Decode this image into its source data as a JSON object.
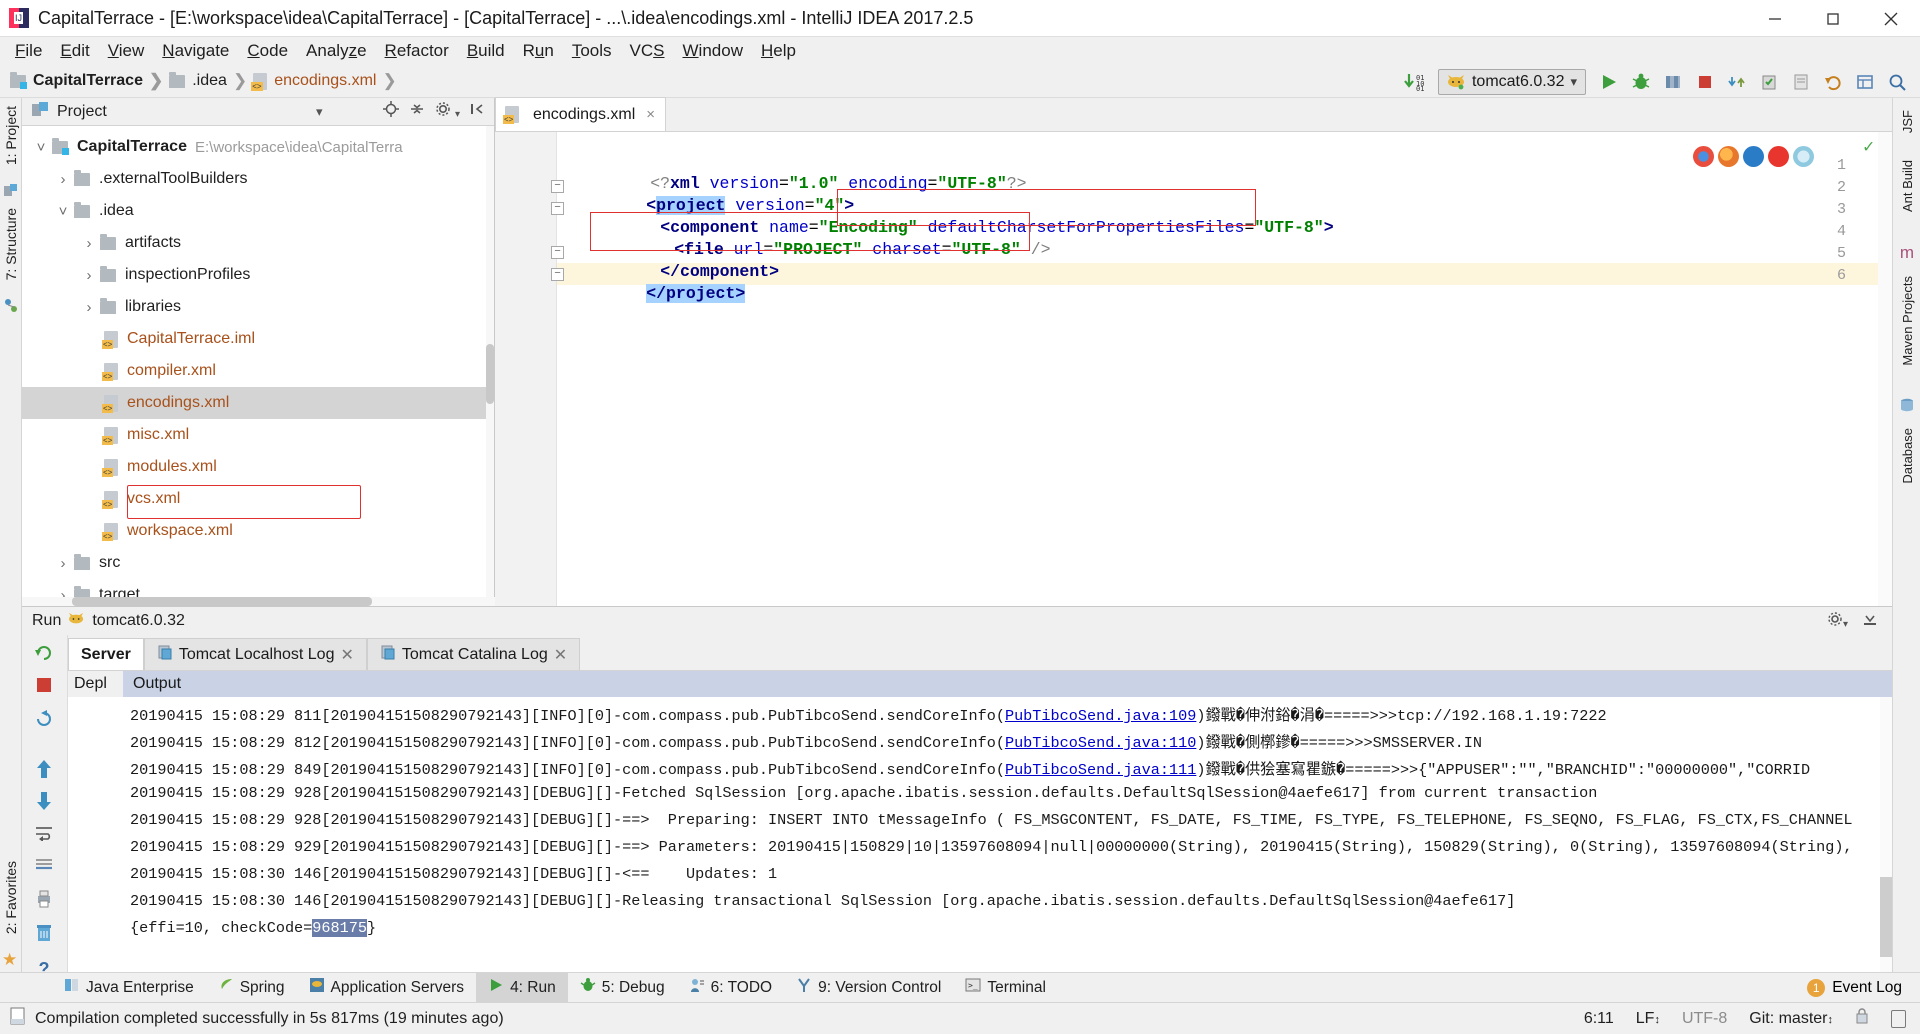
{
  "window": {
    "title": "CapitalTerrace - [E:\\workspace\\idea\\CapitalTerrace] - [CapitalTerrace] - ...\\.idea\\encodings.xml - IntelliJ IDEA 2017.2.5",
    "minimize_label": "minimize-icon",
    "maximize_label": "maximize-icon",
    "close_label": "close-icon"
  },
  "menu": {
    "items": [
      {
        "label": "File",
        "mnemonic": "F"
      },
      {
        "label": "Edit",
        "mnemonic": "E"
      },
      {
        "label": "View",
        "mnemonic": "V"
      },
      {
        "label": "Navigate",
        "mnemonic": "N"
      },
      {
        "label": "Code",
        "mnemonic": "C"
      },
      {
        "label": "Analyze",
        "mnemonic": "z"
      },
      {
        "label": "Refactor",
        "mnemonic": "R"
      },
      {
        "label": "Build",
        "mnemonic": "B"
      },
      {
        "label": "Run",
        "mnemonic": "u"
      },
      {
        "label": "Tools",
        "mnemonic": "T"
      },
      {
        "label": "VCS",
        "mnemonic": "S"
      },
      {
        "label": "Window",
        "mnemonic": "W"
      },
      {
        "label": "Help",
        "mnemonic": "H"
      }
    ]
  },
  "breadcrumb": {
    "items": [
      {
        "label": "CapitalTerrace",
        "icon": "module-folder-icon"
      },
      {
        "label": ".idea",
        "icon": "folder-icon"
      },
      {
        "label": "encodings.xml",
        "icon": "xml-file-icon"
      }
    ]
  },
  "toolbar": {
    "run_config": "tomcat6.0.32",
    "run_config_icon": "tomcat-cat-icon",
    "update_icon": "update-running-application-icon",
    "buttons": [
      "run-button",
      "debug-button",
      "run-coverage-button",
      "stop-button",
      "vcs-update-button",
      "vcs-commit-button",
      "vcs-rollback-button",
      "undo-button",
      "settings-button",
      "search-everywhere-button"
    ]
  },
  "left_strip": {
    "project_label": "1: Project",
    "structure_label": "7: Structure",
    "favorites_label": "2: Favorites"
  },
  "right_strip": {
    "items": [
      "JSF",
      "Ant Build",
      "Maven Projects",
      "Database"
    ]
  },
  "project_panel": {
    "title": "Project",
    "header_icons": [
      "project-view-icon",
      "chevron-down-icon",
      "locate-icon",
      "collapse-all-icon",
      "settings-gear-icon",
      "hide-icon"
    ],
    "tree": [
      {
        "label": "CapitalTerrace",
        "path": "E:\\workspace\\idea\\CapitalTerra",
        "indent": 0,
        "state": "expanded",
        "icon": "module-folder-icon",
        "bold": true
      },
      {
        "label": ".externalToolBuilders",
        "indent": 1,
        "state": "collapsed",
        "icon": "folder-icon"
      },
      {
        "label": ".idea",
        "indent": 1,
        "state": "expanded",
        "icon": "folder-icon"
      },
      {
        "label": "artifacts",
        "indent": 2,
        "state": "collapsed",
        "icon": "folder-icon"
      },
      {
        "label": "inspectionProfiles",
        "indent": 2,
        "state": "collapsed",
        "icon": "folder-icon"
      },
      {
        "label": "libraries",
        "indent": 2,
        "state": "collapsed",
        "icon": "folder-icon"
      },
      {
        "label": "CapitalTerrace.iml",
        "indent": 2,
        "state": "leaf",
        "icon": "iml-file-icon",
        "orange": true
      },
      {
        "label": "compiler.xml",
        "indent": 2,
        "state": "leaf",
        "icon": "xml-file-icon",
        "orange": true
      },
      {
        "label": "encodings.xml",
        "indent": 2,
        "state": "leaf",
        "icon": "xml-file-icon",
        "orange": true,
        "selected": true,
        "highlighted": true
      },
      {
        "label": "misc.xml",
        "indent": 2,
        "state": "leaf",
        "icon": "xml-file-icon",
        "orange": true
      },
      {
        "label": "modules.xml",
        "indent": 2,
        "state": "leaf",
        "icon": "xml-file-icon",
        "orange": true
      },
      {
        "label": "vcs.xml",
        "indent": 2,
        "state": "leaf",
        "icon": "xml-file-icon",
        "orange": true
      },
      {
        "label": "workspace.xml",
        "indent": 2,
        "state": "leaf",
        "icon": "xml-file-icon",
        "orange": true
      },
      {
        "label": "src",
        "indent": 1,
        "state": "collapsed",
        "icon": "folder-icon"
      },
      {
        "label": "target",
        "indent": 1,
        "state": "collapsed",
        "icon": "folder-icon"
      }
    ]
  },
  "editor": {
    "tab": {
      "label": "encodings.xml",
      "icon": "xml-file-icon",
      "close": "×"
    },
    "lines": [
      {
        "n": 1,
        "indent": 0,
        "text": "<?xml version=\"1.0\" encoding=\"UTF-8\"?>"
      },
      {
        "n": 2,
        "indent": 0,
        "text": "<project version=\"4\">",
        "fold": true
      },
      {
        "n": 3,
        "indent": 1,
        "text": "<component name=\"Encoding\" defaultCharsetForPropertiesFiles=\"UTF-8\">",
        "fold": true
      },
      {
        "n": 4,
        "indent": 2,
        "text": "<file url=\"PROJECT\" charset=\"UTF-8\" />"
      },
      {
        "n": 5,
        "indent": 1,
        "text": "</component>",
        "fold": true
      },
      {
        "n": 6,
        "indent": 0,
        "text": "</project>",
        "fold": true,
        "current": true
      }
    ],
    "inspection_status": "ok-check-icon",
    "browsers": [
      "chrome-icon",
      "firefox-icon",
      "edge-icon",
      "opera-icon",
      "safari-icon"
    ]
  },
  "run_window": {
    "title": "Run",
    "config_name": "tomcat6.0.32",
    "config_icon": "tomcat-cat-icon",
    "tabs": [
      {
        "label": "Server",
        "active": true,
        "closable": false,
        "icon": null
      },
      {
        "label": "Tomcat Localhost Log",
        "active": false,
        "closable": true,
        "icon": "log-file-icon"
      },
      {
        "label": "Tomcat Catalina Log",
        "active": false,
        "closable": true,
        "icon": "log-file-icon"
      }
    ],
    "output_header": {
      "left": "Depl",
      "label": "Output"
    },
    "side_buttons": [
      "rerun-icon",
      "stop-icon",
      "rerun-failed-icon",
      "up-arrow-icon",
      "down-arrow-icon",
      "restart-icon",
      "soft-wrap-icon",
      "scroll-to-end-icon",
      "print-icon",
      "clear-all-icon",
      "help-icon"
    ],
    "console_lines": [
      {
        "pre": "20190415 15:08:29 811[201904151508290792143][INFO][0]-com.compass.pub.PubTibcoSend.sendCoreInfo(",
        "link": "PubTibcoSend.java:109",
        "post": ")鏺戰�伸泭鋊�涓�=====>>>tcp://192.168.1.19:7222"
      },
      {
        "pre": "20190415 15:08:29 812[201904151508290792143][INFO][0]-com.compass.pub.PubTibcoSend.sendCoreInfo(",
        "link": "PubTibcoSend.java:110",
        "post": ")鏺戰�側槨鏒�=====>>>SMSSERVER.IN"
      },
      {
        "pre": "20190415 15:08:29 849[201904151508290792143][INFO][0]-com.compass.pub.PubTibcoSend.sendCoreInfo(",
        "link": "PubTibcoSend.java:111",
        "post": ")鏺戰�供狯塞寫瞿鏃�=====>>>{\"APPUSER\":\"\",\"BRANCHID\":\"00000000\",\"CORRID"
      },
      {
        "pre": "20190415 15:08:29 928[201904151508290792143][DEBUG][]-Fetched SqlSession [org.apache.ibatis.session.defaults.DefaultSqlSession@4aefe617] from current transaction",
        "link": "",
        "post": ""
      },
      {
        "pre": "20190415 15:08:29 928[201904151508290792143][DEBUG][]-==>  Preparing: INSERT INTO tMessageInfo ( FS_MSGCONTENT, FS_DATE, FS_TIME, FS_TYPE, FS_TELEPHONE, FS_SEQNO, FS_FLAG, FS_CTX,FS_CHANNEL",
        "link": "",
        "post": ""
      },
      {
        "pre": "20190415 15:08:29 929[201904151508290792143][DEBUG][]-==> Parameters: 20190415|150829|10|13597608094|null|00000000(String), 20190415(String), 150829(String), 0(String), 13597608094(String),",
        "link": "",
        "post": ""
      },
      {
        "pre": "20190415 15:08:30 146[201904151508290792143][DEBUG][]-<==    Updates: 1",
        "link": "",
        "post": ""
      },
      {
        "pre": "20190415 15:08:30 146[201904151508290792143][DEBUG][]-Releasing transactional SqlSession [org.apache.ibatis.session.defaults.DefaultSqlSession@4aefe617]",
        "link": "",
        "post": ""
      },
      {
        "pre": "{effi=10, checkCode=",
        "link": "",
        "post": "}",
        "selected": "968175"
      }
    ]
  },
  "bottom_bar": {
    "buttons": [
      {
        "label": "Java Enterprise",
        "icon": "java-enterprise-icon",
        "active": false
      },
      {
        "label": "Spring",
        "icon": "spring-leaf-icon",
        "active": false
      },
      {
        "label": "Application Servers",
        "icon": "app-servers-icon",
        "active": false
      },
      {
        "label": "4: Run",
        "icon": "run-play-icon",
        "active": true,
        "mnemonic": "4"
      },
      {
        "label": "5: Debug",
        "icon": "debug-bug-icon",
        "active": false,
        "mnemonic": "5"
      },
      {
        "label": "6: TODO",
        "icon": "todo-icon",
        "active": false,
        "mnemonic": "6"
      },
      {
        "label": "9: Version Control",
        "icon": "version-control-icon",
        "active": false,
        "mnemonic": "9"
      },
      {
        "label": "Terminal",
        "icon": "terminal-icon",
        "active": false
      }
    ],
    "event_log": {
      "label": "Event Log",
      "count": "1"
    }
  },
  "status_bar": {
    "message": "Compilation completed successfully in 5s 817ms (19 minutes ago)",
    "caret": "6:11",
    "line_sep": "LF",
    "encoding": "UTF-8",
    "branch": "Git: master",
    "lock_icon": "lock-icon",
    "memory_icon": "memory-indicator-icon"
  }
}
